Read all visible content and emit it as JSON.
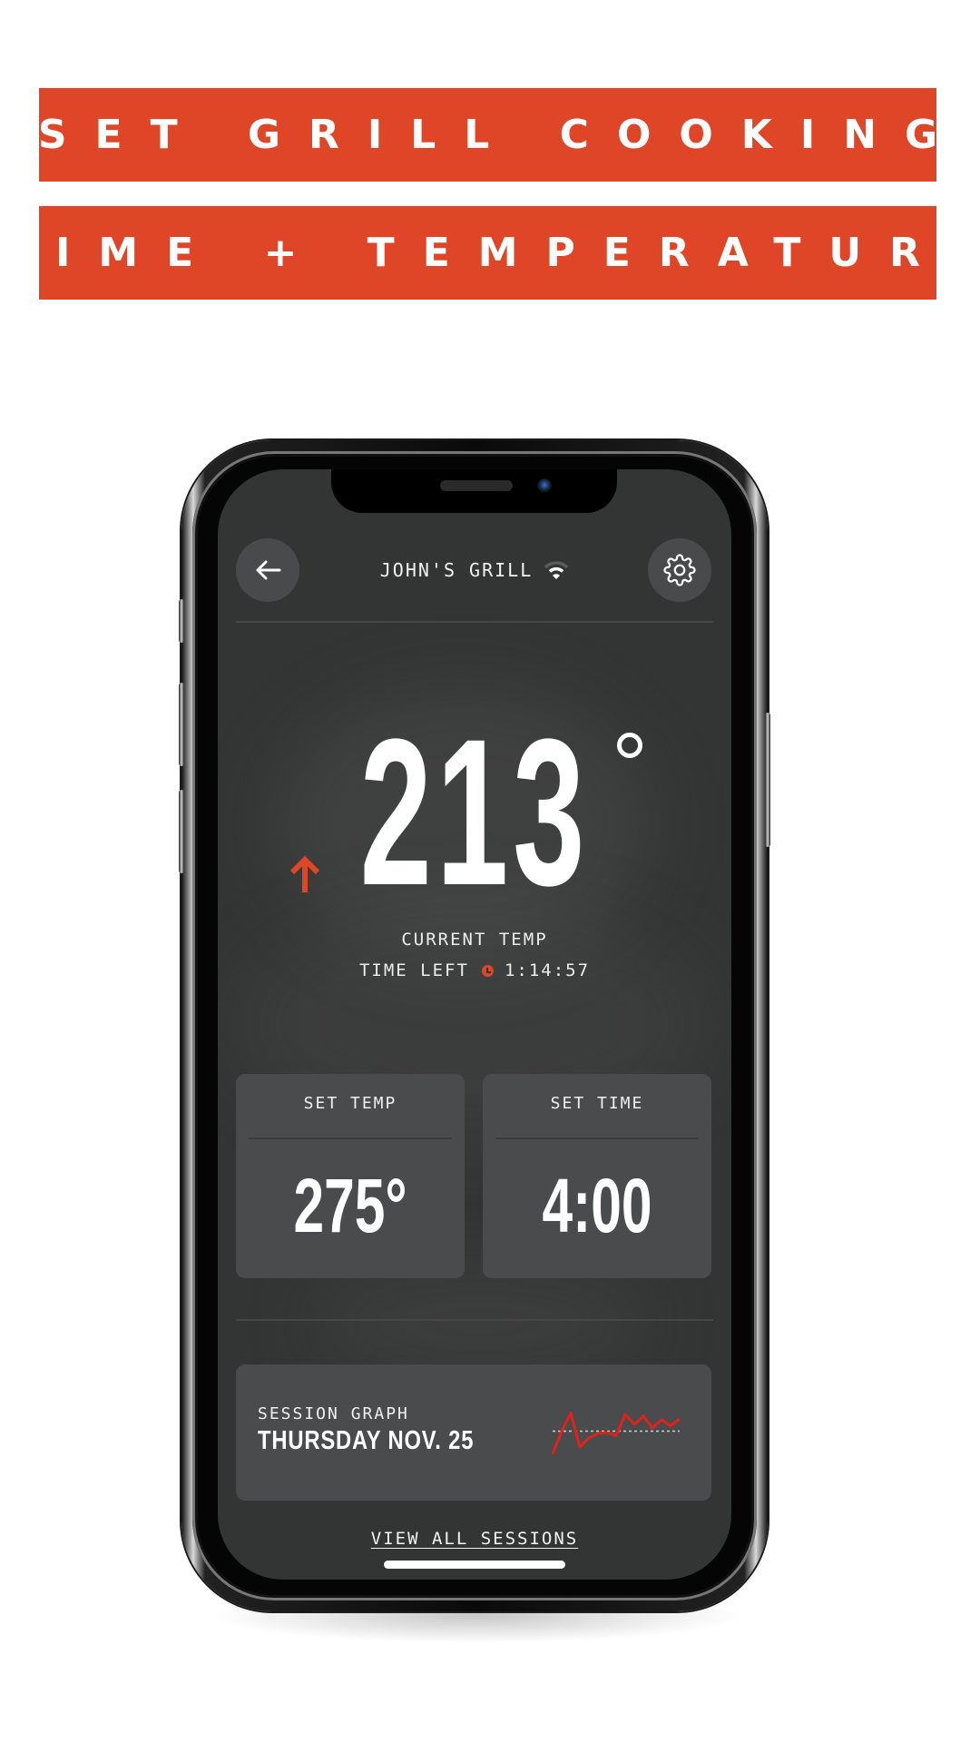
{
  "banner": {
    "line1": "SET GRILL COOKING",
    "line2": "TIME + TEMPERATURE",
    "color": "#df4527"
  },
  "app": {
    "header": {
      "back_icon": "arrow-left-icon",
      "title": "JOHN'S GRILL",
      "wifi_icon": "wifi-icon",
      "settings_icon": "gear-icon"
    },
    "current": {
      "temperature": "213",
      "degree_symbol": "°",
      "trend": "up",
      "trend_icon": "arrow-up-icon",
      "label": "CURRENT TEMP",
      "time_left_label": "TIME LEFT",
      "time_left_icon": "clock-icon",
      "time_left_value": "1:14:57"
    },
    "cards": [
      {
        "label": "SET TEMP",
        "value": "275°"
      },
      {
        "label": "SET TIME",
        "value": "4:00"
      }
    ],
    "session": {
      "label": "SESSION GRAPH",
      "date": "THURSDAY NOV. 25",
      "sparkline_target_fraction": 0.55,
      "sparkline_values": [
        0.05,
        0.55,
        0.95,
        0.2,
        0.4,
        0.5,
        0.52,
        0.45,
        0.92,
        0.7,
        0.88,
        0.62,
        0.8,
        0.67,
        0.82
      ],
      "line_color": "#e0211c"
    },
    "view_all": "VIEW ALL SESSIONS",
    "accent_color": "#df4527"
  }
}
